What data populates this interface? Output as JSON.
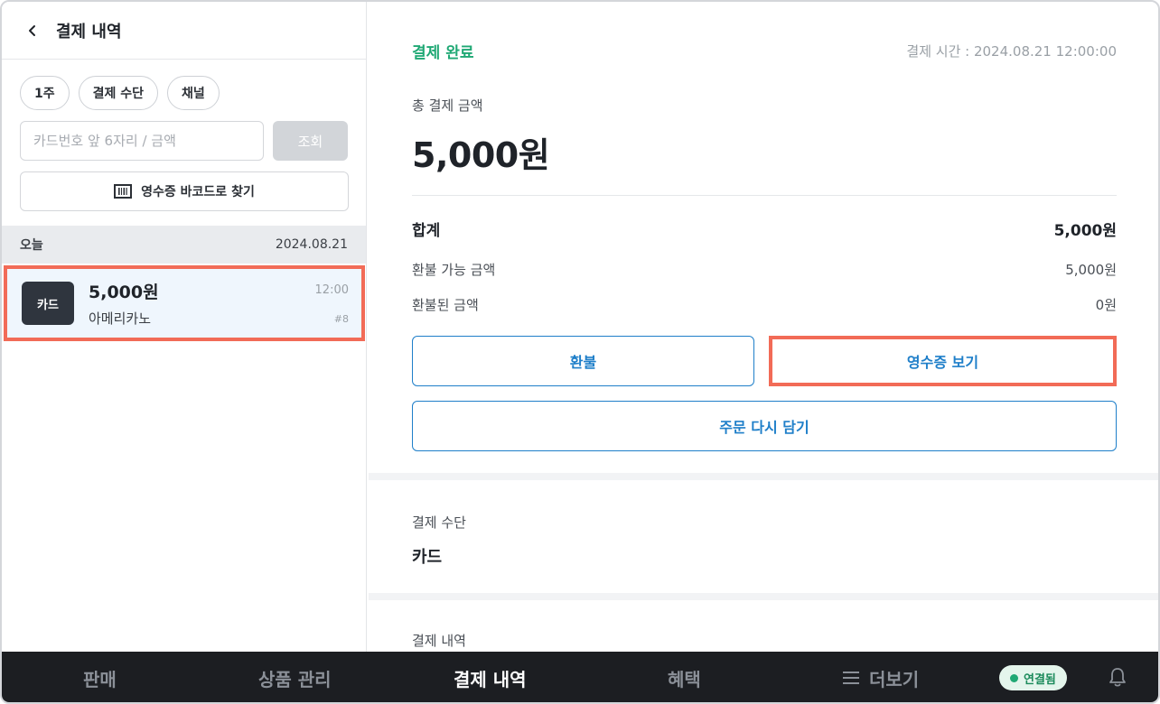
{
  "left": {
    "title": "결제 내역",
    "chips": [
      "1주",
      "결제 수단",
      "채널"
    ],
    "search_placeholder": "카드번호 앞 6자리 / 금액",
    "search_button": "조회",
    "barcode_button": "영수증 바코드로 찾기",
    "date_label": "오늘",
    "date_value": "2024.08.21",
    "transaction": {
      "badge": "카드",
      "amount": "5,000원",
      "name": "아메리카노",
      "time": "12:00",
      "number": "#8"
    }
  },
  "detail": {
    "status": "결제 완료",
    "pay_time": "결제 시간 : 2024.08.21 12:00:00",
    "total_label": "총 결제 금액",
    "total_amount": "5,000원",
    "sum_label": "합계",
    "sum_value": "5,000원",
    "refundable_label": "환불 가능 금액",
    "refundable_value": "5,000원",
    "refunded_label": "환불된 금액",
    "refunded_value": "0원",
    "refund_button": "환불",
    "receipt_button": "영수증 보기",
    "reorder_button": "주문 다시 담기",
    "method_label": "결제 수단",
    "method_value": "카드",
    "history_label": "결제 내역"
  },
  "nav": {
    "items": [
      "판매",
      "상품 관리",
      "결제 내역",
      "혜택",
      "더보기"
    ],
    "active": "결제 내역",
    "connected": "연결됨"
  },
  "colors": {
    "status_green": "#1fa874",
    "accent_blue": "#1f7fc9",
    "highlight_red": "#f26b57",
    "nav_bg": "#1c1e22"
  },
  "icons": [
    "chevron-left-icon",
    "barcode-icon",
    "menu-icon",
    "bell-icon"
  ]
}
